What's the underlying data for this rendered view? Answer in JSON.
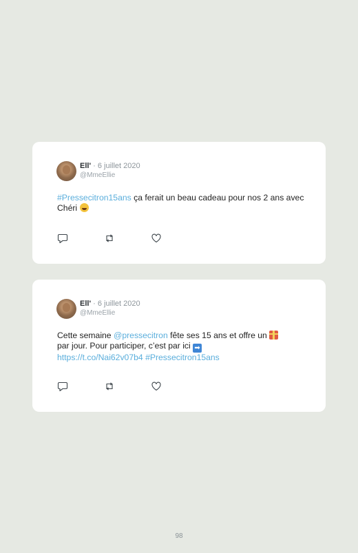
{
  "tweets": [
    {
      "name": "Ell'",
      "date": " · 6 juillet 2020",
      "handle": "@MmeEllie",
      "hashtag": "#Pressecitron15ans",
      "text_rest": " ça ferait un beau cadeau pour nos 2 ans avec Chéri ",
      "emoji": "laughing-emoji"
    },
    {
      "name": "Ell'",
      "date": " · 6 juillet 2020",
      "handle": "@MmeEllie",
      "text_start": "Cette semaine ",
      "mention": "@pressecitron",
      "text_mid": " fête ses 15 ans et offre un ",
      "gift_emoji": "gift-emoji",
      "text_mid2": " par jour. Pour participer, c’est par ici ",
      "arrow_emoji": "arrow-right-emoji",
      "url": "https://t.co/Nai62v07b4",
      "hashtag": "#Pressecitron15ans"
    }
  ],
  "actions": [
    "reply-icon",
    "retweet-icon",
    "like-icon"
  ],
  "colors": {
    "background": "#e6e9e3",
    "link": "#5aaedc",
    "card": "#ffffff"
  },
  "page_number": "98"
}
